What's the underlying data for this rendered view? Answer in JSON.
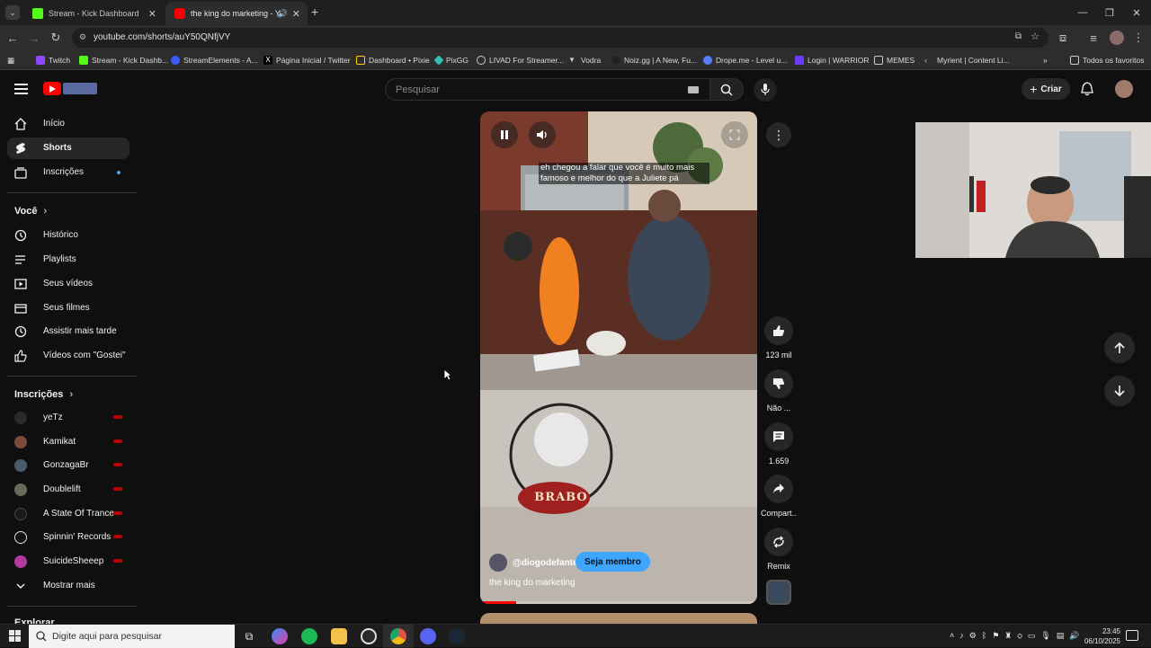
{
  "browser": {
    "tabs": [
      {
        "title": "Stream - Kick Dashboard",
        "active": false
      },
      {
        "title": "the king do marketing - Yo",
        "active": true
      }
    ],
    "url": "youtube.com/shorts/auY50QNfjVY",
    "bookmarks": [
      "Twitch",
      "Stream - Kick Dashb...",
      "StreamElements - A...",
      "Página Inicial / Twitter",
      "Dashboard • Pixie",
      "PixGG",
      "LIVAD For Streamer...",
      "Vodra",
      "Noiz.gg | A New, Fu...",
      "Drope.me - Level u...",
      "Login | WARRIOR",
      "MEMES",
      "Myrient | Content Li...",
      "Todos os favoritos"
    ]
  },
  "header": {
    "search_placeholder": "Pesquisar",
    "create_label": "Criar"
  },
  "sidebar": {
    "main": [
      {
        "label": "Início"
      },
      {
        "label": "Shorts"
      },
      {
        "label": "Inscrições"
      }
    ],
    "you_heading": "Você",
    "you_items": [
      {
        "label": "Histórico"
      },
      {
        "label": "Playlists"
      },
      {
        "label": "Seus vídeos"
      },
      {
        "label": "Seus filmes"
      },
      {
        "label": "Assistir mais tarde"
      },
      {
        "label": "Vídeos com \"Gostei\""
      }
    ],
    "subs_heading": "Inscrições",
    "subs": [
      {
        "label": "yeTz",
        "color": "#2b2b2b"
      },
      {
        "label": "Kamikat",
        "color": "#7a4a3a"
      },
      {
        "label": "GonzagaBr",
        "color": "#4a5a6a"
      },
      {
        "label": "Doublelift",
        "color": "#6a6a5a"
      },
      {
        "label": "A State Of Trance",
        "color": "#1a1a1a"
      },
      {
        "label": "Spinnin' Records",
        "color": "#111111"
      },
      {
        "label": "SuicideSheeep",
        "color": "#b03aa0"
      }
    ],
    "show_more": "Mostrar mais",
    "explore_heading": "Explorar"
  },
  "short": {
    "subtitle": "eh chegou a falar que você é muito mais famoso e melhor do que a Juliete pá",
    "sign_text": "BRABO",
    "channel": "@diogodefante",
    "member_label": "Seja membro",
    "title": "the king do marketing",
    "progress": 0.13
  },
  "actions": {
    "likes": "123 mil",
    "dislike": "Não ...",
    "comments": "1.659",
    "share": "Compart...",
    "remix": "Remix"
  },
  "taskbar": {
    "search_placeholder": "Digite aqui para pesquisar",
    "time": "23:45",
    "date": "06/10/2025"
  }
}
